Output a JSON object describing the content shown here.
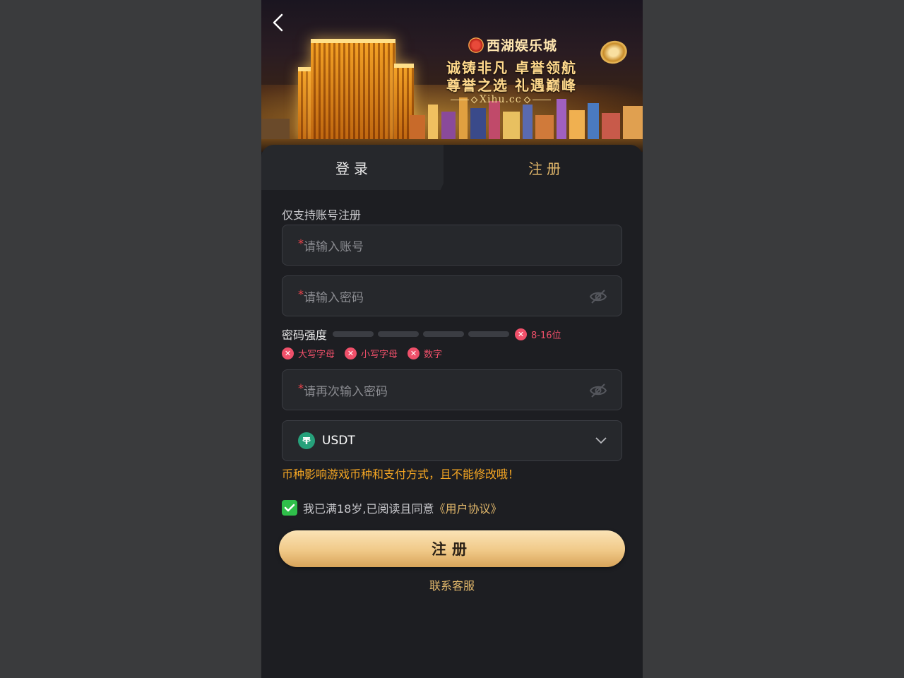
{
  "banner": {
    "brand": "西湖娱乐城",
    "slogan_line1": "诚铸非凡 卓誉领航",
    "slogan_line2": "尊誉之选 礼遇巅峰",
    "domain": "Xihu.cc"
  },
  "tabs": {
    "login": "登录",
    "register": "注册",
    "active": "register"
  },
  "form": {
    "section_label": "仅支持账号注册",
    "required_mark": "*",
    "account_placeholder": "请输入账号",
    "password_placeholder": "请输入密码",
    "confirm_placeholder": "请再次输入密码",
    "strength_label": "密码强度",
    "strength_level": 0,
    "rules": [
      "8-16位",
      "大写字母",
      "小写字母",
      "数字"
    ],
    "currency": "USDT",
    "currency_warning": "币种影响游戏币种和支付方式，且不能修改哦！",
    "agree_text": "我已满18岁,已阅读且同意",
    "agree_link": "《用户协议》",
    "agree_checked": true,
    "submit_label": "注册",
    "support_label": "联系客服"
  },
  "colors": {
    "accent_gold": "#e2b86b",
    "error_red": "#f0506a",
    "warning_orange": "#f5a623",
    "check_green": "#2fbf4a",
    "usdt_green": "#26a17b"
  },
  "icons": [
    "back-arrow-icon",
    "eye-off-icon",
    "close-x-icon",
    "usdt-icon",
    "chevron-down-icon",
    "check-icon"
  ]
}
